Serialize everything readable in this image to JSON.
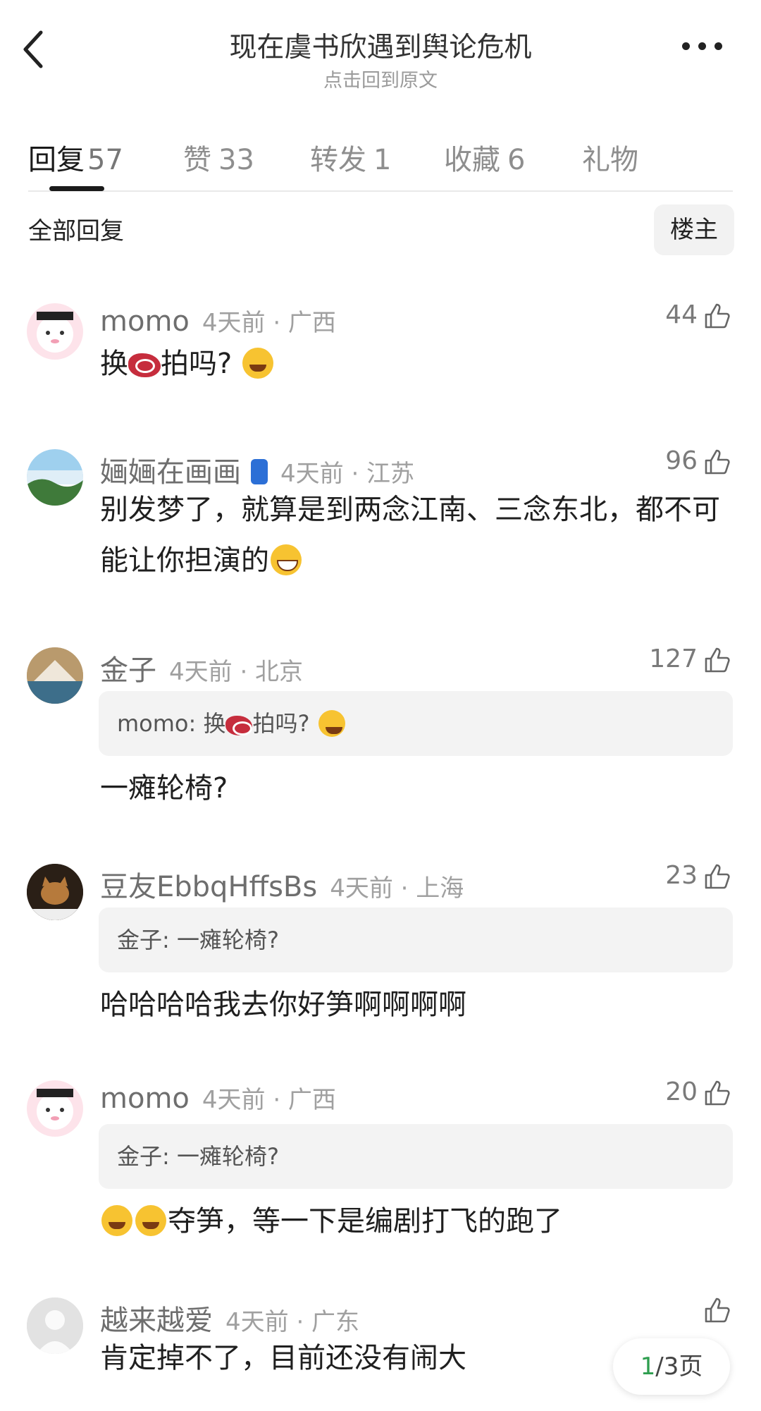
{
  "header": {
    "title": "现在虞书欣遇到舆论危机",
    "subtitle": "点击回到原文"
  },
  "tabs": [
    {
      "label": "回复",
      "count": "57"
    },
    {
      "label": "赞",
      "count": "33"
    },
    {
      "label": "转发",
      "count": "1"
    },
    {
      "label": "收藏",
      "count": "6"
    },
    {
      "label": "礼物",
      "count": ""
    }
  ],
  "filter": {
    "label": "全部回复",
    "owner_button": "楼主"
  },
  "comments": [
    {
      "user": "momo",
      "time": "4天前 · 广西",
      "likes": "44",
      "quote": "",
      "text_pre": "换",
      "text_mid": "拍吗?",
      "text_post": ""
    },
    {
      "user": "婳婳在画画",
      "time": "4天前 · 江苏",
      "likes": "96",
      "quote": "",
      "text": "别发梦了，就算是到两念江南、三念东北，都不可能让你担演的"
    },
    {
      "user": "金子",
      "time": "4天前 · 北京",
      "likes": "127",
      "quote_user": "momo:",
      "quote_pre": "换",
      "quote_post": "拍吗?",
      "text": "一瘫轮椅?"
    },
    {
      "user": "豆友EbbqHffsBs",
      "time": "4天前 · 上海",
      "likes": "23",
      "quote": "金子: 一瘫轮椅?",
      "text": "哈哈哈哈我去你好笋啊啊啊啊"
    },
    {
      "user": "momo",
      "time": "4天前 · 广西",
      "likes": "20",
      "quote": "金子: 一瘫轮椅?",
      "text": "夺笋，等一下是编剧打飞的跑了"
    },
    {
      "user": "越来越爱",
      "time": "4天前 · 广东",
      "likes": "",
      "quote": "",
      "text": "肯定掉不了，目前还没有闹大"
    }
  ],
  "pager": {
    "current": "1",
    "total": "/3页"
  }
}
